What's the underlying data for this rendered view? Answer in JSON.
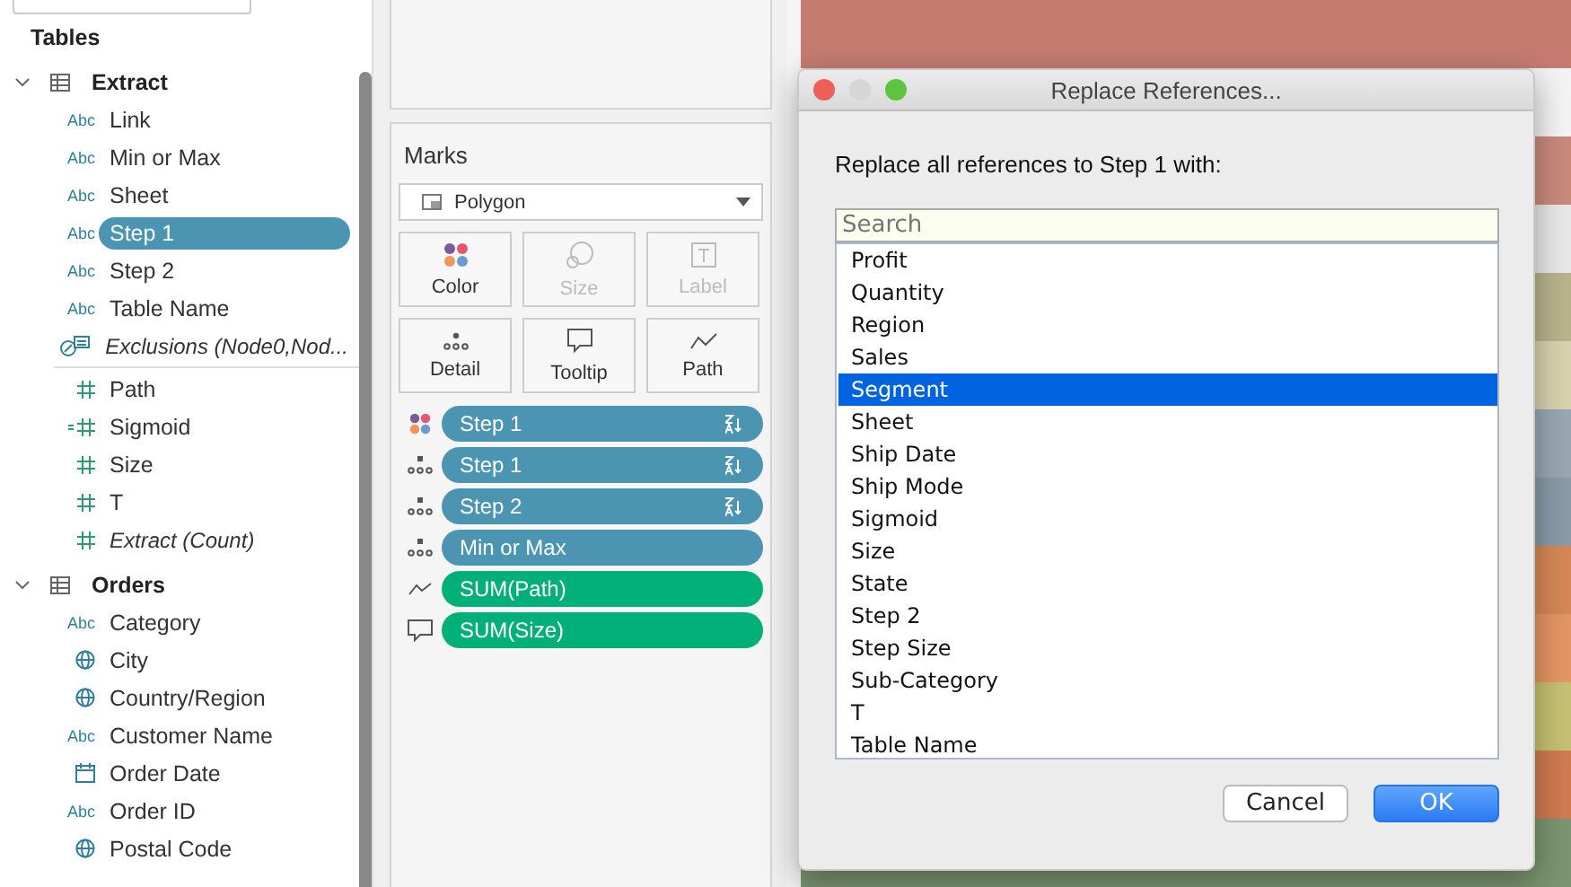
{
  "data_pane": {
    "heading": "Tables",
    "tables": [
      {
        "name": "Extract",
        "expanded": true,
        "fields": [
          {
            "kind": "string",
            "type_glyph": "Abc",
            "name": "Link",
            "italic": false,
            "selected": false
          },
          {
            "kind": "string",
            "type_glyph": "Abc",
            "name": "Min or Max",
            "italic": false,
            "selected": false
          },
          {
            "kind": "string",
            "type_glyph": "Abc",
            "name": "Sheet",
            "italic": false,
            "selected": false
          },
          {
            "kind": "string",
            "type_glyph": "Abc",
            "name": "Step 1",
            "italic": false,
            "selected": true
          },
          {
            "kind": "string",
            "type_glyph": "Abc",
            "name": "Step 2",
            "italic": false,
            "selected": false
          },
          {
            "kind": "string",
            "type_glyph": "Abc",
            "name": "Table Name",
            "italic": false,
            "selected": false
          },
          {
            "kind": "set",
            "name": "Exclusions (Node0,Nod...",
            "italic": true,
            "selected": false
          },
          {
            "kind": "divider"
          },
          {
            "kind": "number",
            "name": "Path",
            "italic": false,
            "selected": false
          },
          {
            "kind": "calc",
            "name": "Sigmoid",
            "italic": false,
            "selected": false
          },
          {
            "kind": "number",
            "name": "Size",
            "italic": false,
            "selected": false
          },
          {
            "kind": "number",
            "name": "T",
            "italic": false,
            "selected": false
          },
          {
            "kind": "number",
            "name": "Extract (Count)",
            "italic": true,
            "selected": false
          }
        ]
      },
      {
        "name": "Orders",
        "expanded": true,
        "fields": [
          {
            "kind": "string",
            "type_glyph": "Abc",
            "name": "Category",
            "italic": false,
            "selected": false
          },
          {
            "kind": "geo",
            "name": "City",
            "italic": false,
            "selected": false
          },
          {
            "kind": "geo",
            "name": "Country/Region",
            "italic": false,
            "selected": false
          },
          {
            "kind": "string",
            "type_glyph": "Abc",
            "name": "Customer Name",
            "italic": false,
            "selected": false
          },
          {
            "kind": "date",
            "name": "Order Date",
            "italic": false,
            "selected": false
          },
          {
            "kind": "string",
            "type_glyph": "Abc",
            "name": "Order ID",
            "italic": false,
            "selected": false
          },
          {
            "kind": "geo",
            "name": "Postal Code",
            "italic": false,
            "selected": false
          }
        ]
      }
    ]
  },
  "marks": {
    "title": "Marks",
    "mark_type": "Polygon",
    "cards": [
      {
        "kind": "color",
        "label": "Color",
        "disabled": false
      },
      {
        "kind": "size",
        "label": "Size",
        "disabled": true
      },
      {
        "kind": "label",
        "label": "Label",
        "disabled": true
      },
      {
        "kind": "detail",
        "label": "Detail",
        "disabled": false
      },
      {
        "kind": "tooltip",
        "label": "Tooltip",
        "disabled": false
      },
      {
        "kind": "path",
        "label": "Path",
        "disabled": false
      }
    ],
    "pills": [
      {
        "kind": "color",
        "label": "Step 1",
        "continuous": false,
        "sorted": true
      },
      {
        "kind": "detail",
        "label": "Step 1",
        "continuous": false,
        "sorted": true
      },
      {
        "kind": "detail",
        "label": "Step 2",
        "continuous": false,
        "sorted": true
      },
      {
        "kind": "detail",
        "label": "Min or Max",
        "continuous": false,
        "sorted": false
      },
      {
        "kind": "path",
        "label": "SUM(Path)",
        "continuous": true,
        "sorted": false
      },
      {
        "kind": "tooltip",
        "label": "SUM(Size)",
        "continuous": true,
        "sorted": false
      }
    ]
  },
  "dialog": {
    "title": "Replace References...",
    "prompt": "Replace all references to Step 1 with:",
    "search": {
      "placeholder": "Search"
    },
    "items": [
      {
        "label": "Profit",
        "selected": false
      },
      {
        "label": "Quantity",
        "selected": false
      },
      {
        "label": "Region",
        "selected": false
      },
      {
        "label": "Sales",
        "selected": false
      },
      {
        "label": "Segment",
        "selected": true
      },
      {
        "label": "Sheet",
        "selected": false
      },
      {
        "label": "Ship Date",
        "selected": false
      },
      {
        "label": "Ship Mode",
        "selected": false
      },
      {
        "label": "Sigmoid",
        "selected": false
      },
      {
        "label": "Size",
        "selected": false
      },
      {
        "label": "State",
        "selected": false
      },
      {
        "label": "Step 2",
        "selected": false
      },
      {
        "label": "Step Size",
        "selected": false
      },
      {
        "label": "Sub-Category",
        "selected": false
      },
      {
        "label": "T",
        "selected": false
      },
      {
        "label": "Table Name",
        "selected": false
      }
    ],
    "buttons": [
      {
        "kind": "cancel",
        "label": "Cancel"
      },
      {
        "kind": "ok",
        "label": "OK"
      }
    ]
  }
}
